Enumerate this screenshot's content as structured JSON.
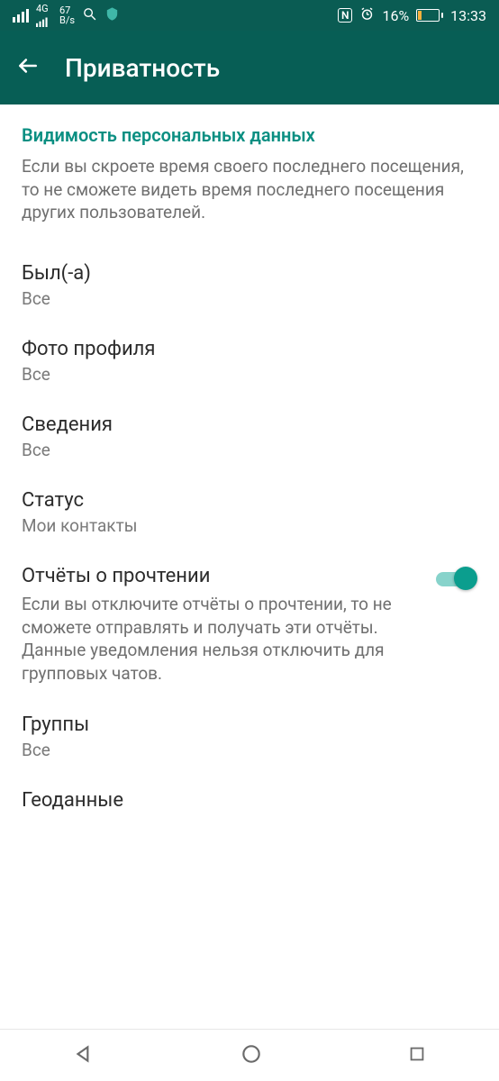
{
  "status": {
    "network_label_top": "4G",
    "speed_value": "67",
    "speed_unit": "B/s",
    "nfc": "N",
    "battery_percent": "16%",
    "battery_fill_pct": 16,
    "time": "13:33"
  },
  "appbar": {
    "title": "Приватность"
  },
  "section": {
    "header": "Видимость персональных данных",
    "description": "Если вы скроете время своего последнего посещения, то не сможете видеть время последнего посещения других пользователей."
  },
  "settings": {
    "last_seen": {
      "title": "Был(-а)",
      "value": "Все"
    },
    "profile_photo": {
      "title": "Фото профиля",
      "value": "Все"
    },
    "about": {
      "title": "Сведения",
      "value": "Все"
    },
    "status_item": {
      "title": "Статус",
      "value": "Мои контакты"
    },
    "read_receipts": {
      "title": "Отчёты о прочтении",
      "description": "Если вы отключите отчёты о прочтении, то не сможете отправлять и получать эти отчёты. Данные уведомления нельзя отключить для групповых чатов.",
      "enabled": true
    },
    "groups": {
      "title": "Группы",
      "value": "Все"
    },
    "live_location": {
      "title": "Геоданные"
    }
  }
}
